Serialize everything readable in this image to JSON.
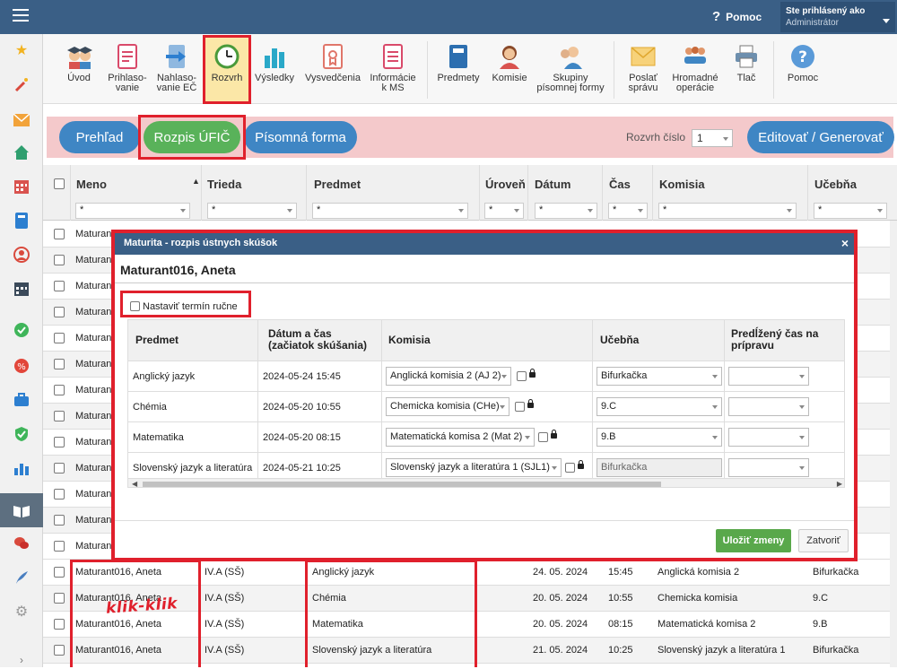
{
  "header": {
    "help_label": "Pomoc",
    "help_glyph": "?",
    "user_label": "Ste prihlásený ako",
    "user_role": "Administrátor"
  },
  "toolbar": {
    "items": [
      {
        "label": "Úvod",
        "icon": "students-icon"
      },
      {
        "label": "Prihlaso-\nvanie",
        "icon": "registration-form-icon"
      },
      {
        "label": "Nahlaso-\nvanie EČ",
        "icon": "report-arrow-icon"
      },
      {
        "label": "Rozvrh",
        "icon": "clock-icon"
      },
      {
        "label": "Výsledky",
        "icon": "bar-chart-icon"
      },
      {
        "label": "Vysvedčenia",
        "icon": "certificate-icon"
      },
      {
        "label": "Informácie\nk MS",
        "icon": "info-document-icon"
      },
      {
        "label": "Predmety",
        "icon": "book-icon"
      },
      {
        "label": "Komisie",
        "icon": "person-icon"
      },
      {
        "label": "Skupiny\npísomnej formy",
        "icon": "group-person-icon"
      },
      {
        "label": "Poslať\nsprávu",
        "icon": "envelope-icon"
      },
      {
        "label": "Hromadné\noperácie",
        "icon": "people-group-icon"
      },
      {
        "label": "Tlač",
        "icon": "printer-icon"
      },
      {
        "label": "Pomoc",
        "icon": "help-icon"
      }
    ]
  },
  "tabs": {
    "overview": "Prehľad",
    "schedule": "Rozpis ÚFIČ",
    "written": "Písomná forma",
    "schedule_number_label": "Rozvrh číslo",
    "schedule_number_value": "1",
    "edit_generate": "Editovať / Generovať"
  },
  "grid": {
    "columns": [
      "Meno",
      "Trieda",
      "Predmet",
      "Úroveň",
      "Dátum",
      "Čas",
      "Komisia",
      "Učebňa"
    ],
    "filter_value": "*",
    "sort_glyph": "▲",
    "hidden_rows_name": "Maturan",
    "rows": [
      {
        "name": "Maturant016, Aneta",
        "class": "IV.A (SŠ)",
        "subject": "Anglický jazyk",
        "date": "24. 05. 2024",
        "time": "15:45",
        "commission": "Anglická komisia 2",
        "room": "Bifurkačka"
      },
      {
        "name": "Maturant016, Aneta",
        "class": "IV.A (SŠ)",
        "subject": "Chémia",
        "date": "20. 05. 2024",
        "time": "10:55",
        "commission": "Chemicka komisia",
        "room": "9.C"
      },
      {
        "name": "Maturant016, Aneta",
        "class": "IV.A (SŠ)",
        "subject": "Matematika",
        "date": "20. 05. 2024",
        "time": "08:15",
        "commission": "Matematická komisa 2",
        "room": "9.B"
      },
      {
        "name": "Maturant016, Aneta",
        "class": "IV.A (SŠ)",
        "subject": "Slovenský jazyk a literatúra",
        "date": "21. 05. 2024",
        "time": "10:25",
        "commission": "Slovenský jazyk a literatúra 1",
        "room": "Bifurkačka"
      }
    ]
  },
  "annotation": "klik-klik",
  "modal": {
    "title": "Maturita - rozpis ústnych skúšok",
    "student": "Maturant016, Aneta",
    "manual_label": "Nastaviť termín ručne",
    "columns": [
      "Predmet",
      "Dátum a čas\n(začiatok skúšania)",
      "Komisia",
      "Učebňa",
      "Predĺžený čas na\nprípravu"
    ],
    "rows": [
      {
        "subject": "Anglický jazyk",
        "datetime": "2024-05-24 15:45",
        "commission": "Anglická komisia 2 (AJ 2)",
        "room": "Bifurkačka",
        "room_disabled": false
      },
      {
        "subject": "Chémia",
        "datetime": "2024-05-20 10:55",
        "commission": "Chemicka komisia (CHe)",
        "room": "9.C",
        "room_disabled": false
      },
      {
        "subject": "Matematika",
        "datetime": "2024-05-20 08:15",
        "commission": "Matematická komisa 2 (Mat 2)",
        "room": "9.B",
        "room_disabled": false
      },
      {
        "subject": "Slovenský jazyk a literatúra",
        "datetime": "2024-05-21 10:25",
        "commission": "Slovenský jazyk a literatúra 1 (SJL1)",
        "room": "Bifurkačka",
        "room_disabled": true
      }
    ],
    "save": "Uložiť zmeny",
    "close": "Zatvoriť",
    "close_glyph": "×"
  },
  "colors": {
    "header_bg": "#3a5f86",
    "tab_blue": "#3f86c4",
    "tab_green": "#59b25a",
    "highlight_red": "#e0202c",
    "tab_bar_bg": "#f4c9cb"
  }
}
